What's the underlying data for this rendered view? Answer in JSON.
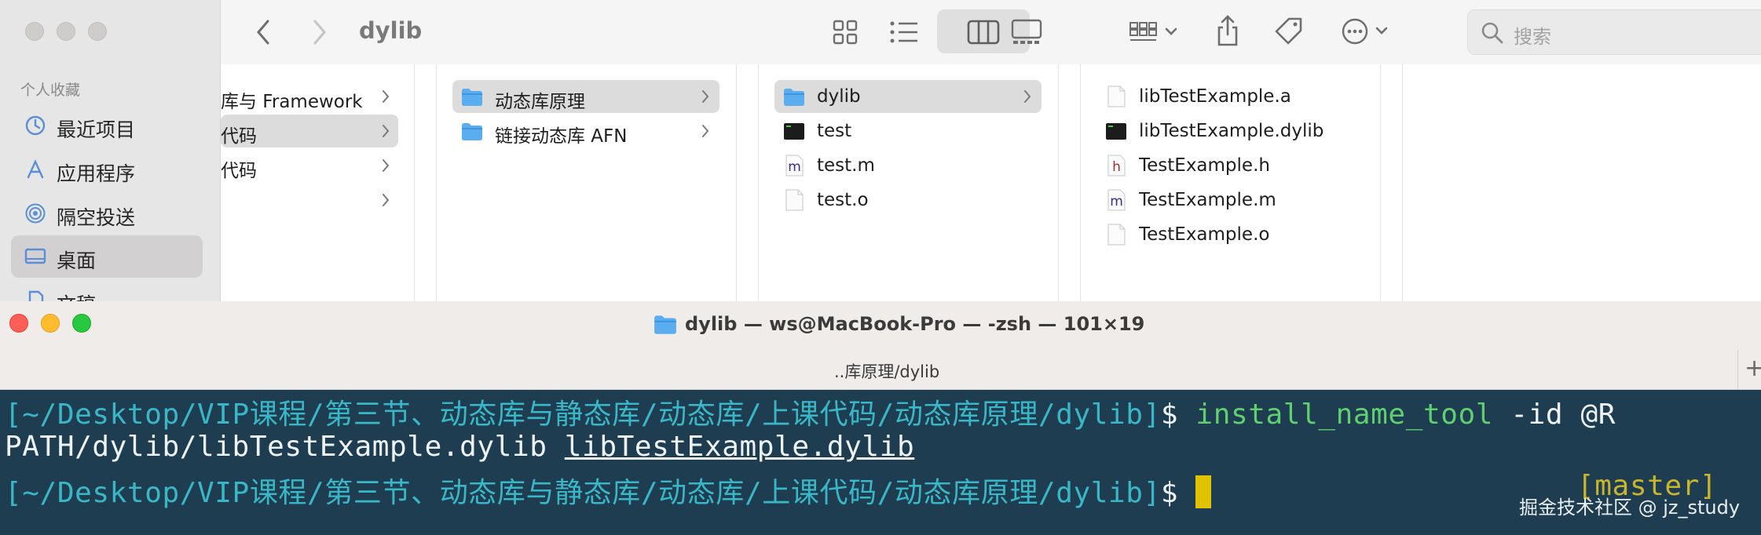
{
  "finder": {
    "title": "dylib",
    "search_placeholder": "搜索",
    "sidebar": {
      "heading": "个人收藏",
      "items": [
        {
          "label": "最近项目",
          "icon": "clock-icon"
        },
        {
          "label": "应用程序",
          "icon": "applications-icon"
        },
        {
          "label": "隔空投送",
          "icon": "airdrop-icon"
        },
        {
          "label": "桌面",
          "icon": "desktop-icon",
          "selected": true
        },
        {
          "label": "文稿",
          "icon": "document-icon"
        }
      ]
    },
    "columns": [
      {
        "items": [
          "库与 Framework",
          "代码",
          "代码",
          ""
        ]
      },
      {
        "items": [
          "动态库原理",
          "链接动态库 AFN"
        ],
        "selected": "动态库原理"
      },
      {
        "items": [
          "dylib",
          "test",
          "test.m",
          "test.o"
        ],
        "selected": "dylib"
      },
      {
        "items": [
          "libTestExample.a",
          "libTestExample.dylib",
          "TestExample.h",
          "TestExample.m",
          "TestExample.o"
        ]
      }
    ]
  },
  "terminal": {
    "title": "dylib — ws@MacBook-Pro — -zsh — 101×19",
    "tab_label": "..库原理/dylib",
    "prompt_path": "[~/Desktop/VIP课程/第三节、动态库与静态库/动态库/上课代码/动态库原理/dylib]",
    "prompt_symbol": "$",
    "command_name": "install_name_tool",
    "command_args_line1": " -id @R",
    "command_line2_plain": "PATH/dylib/libTestExample.dylib ",
    "command_line2_underlined": "libTestExample.dylib",
    "git_branch": "[master]",
    "watermark": "掘金技术社区 @ jz_study"
  },
  "colors": {
    "prompt": "#3ab7c7",
    "command": "#5fcf6f",
    "cursor": "#e0c200",
    "terminal_bg": "#1f3d50"
  }
}
